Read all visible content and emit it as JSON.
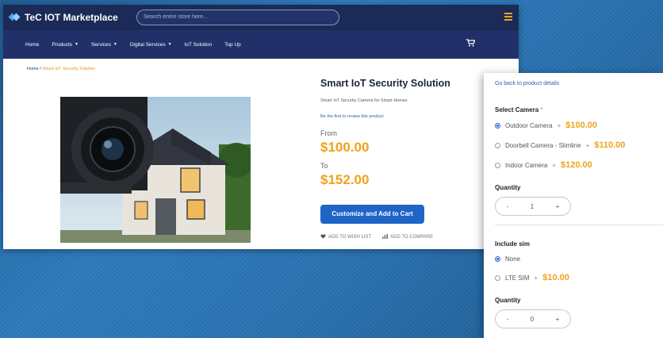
{
  "header": {
    "brand": "TeC IOT Marketplace",
    "search_placeholder": "Search entire store here..."
  },
  "nav": {
    "items": [
      {
        "label": "Home",
        "has_dropdown": false
      },
      {
        "label": "Products",
        "has_dropdown": true
      },
      {
        "label": "Services",
        "has_dropdown": true
      },
      {
        "label": "Digital Services",
        "has_dropdown": true
      },
      {
        "label": "IoT Solution",
        "has_dropdown": false
      },
      {
        "label": "Top Up",
        "has_dropdown": false
      }
    ]
  },
  "breadcrumb": {
    "home": "Home",
    "separator": "/",
    "current": "Smart IoT Security Solution"
  },
  "product": {
    "title": "Smart IoT Security Solution",
    "description": "Smart IoT Security Camera for Smart Homes",
    "review_link": "Be the first to review this product",
    "from_label": "From",
    "from_price": "$100.00",
    "to_label": "To",
    "to_price": "$152.00",
    "cta": "Customize and Add to Cart",
    "wishlist": "ADD TO WISH LIST",
    "compare": "ADD TO COMPARE"
  },
  "customize": {
    "back_link": "Go back to product details",
    "camera": {
      "label": "Select Camera",
      "required_mark": "*",
      "options": [
        {
          "name": "Outdoor Camera",
          "price": "$100.00",
          "selected": true
        },
        {
          "name": "Doorbell Camera - Slimline",
          "price": "$110.00",
          "selected": false
        },
        {
          "name": "Indoor Camera",
          "price": "$120.00",
          "selected": false
        }
      ],
      "qty_label": "Quantity",
      "qty_value": "1"
    },
    "sim": {
      "label": "Include sim",
      "options": [
        {
          "name": "None",
          "price": "",
          "selected": true
        },
        {
          "name": "LTE SIM",
          "price": "$10.00",
          "selected": false
        }
      ],
      "qty_label": "Quantity",
      "qty_value": "0"
    },
    "plus_sign": "+",
    "minus_sign": "-"
  },
  "icons": {
    "menu": "hamburger-icon",
    "cart": "cart-icon",
    "heart": "heart-icon",
    "compare": "bar-chart-icon"
  },
  "colors": {
    "header_bg": "#1b2a56",
    "nav_bg": "#22306a",
    "price": "#f0a21a",
    "button": "#1f65c8",
    "link": "#3b5aa5"
  }
}
